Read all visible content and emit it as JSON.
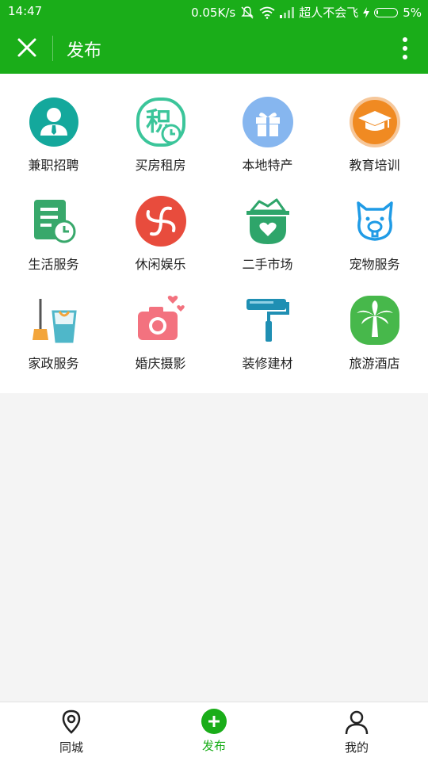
{
  "status_bar": {
    "time": "14:47",
    "speed": "0.05K/s",
    "carrier": "超人不会飞",
    "battery": "5%"
  },
  "header": {
    "title": "发布",
    "close_icon": "close-icon",
    "more_icon": "more-vertical-icon"
  },
  "categories": [
    {
      "label": "兼职招聘",
      "icon": "job-icon",
      "color": "#14a89c"
    },
    {
      "label": "买房租房",
      "icon": "housing-icon",
      "color": "#3bc59a"
    },
    {
      "label": "本地特产",
      "icon": "gift-icon",
      "color": "#86b6ef"
    },
    {
      "label": "教育培训",
      "icon": "graduation-cap-icon",
      "color": "#f08a22"
    },
    {
      "label": "生活服务",
      "icon": "service-icon",
      "color": "#38a86b"
    },
    {
      "label": "休闲娱乐",
      "icon": "entertainment-icon",
      "color": "#e84c3d"
    },
    {
      "label": "二手市场",
      "icon": "second-hand-icon",
      "color": "#2ea56a"
    },
    {
      "label": "宠物服务",
      "icon": "pet-icon",
      "color": "#1f9be6"
    },
    {
      "label": "家政服务",
      "icon": "housekeeping-icon",
      "color": "#4fb7c9"
    },
    {
      "label": "婚庆摄影",
      "icon": "camera-icon",
      "color": "#f3727f"
    },
    {
      "label": "装修建材",
      "icon": "paint-roller-icon",
      "color": "#1f8fb3"
    },
    {
      "label": "旅游酒店",
      "icon": "palm-tree-icon",
      "color": "#47b84b"
    }
  ],
  "tab_bar": {
    "items": [
      {
        "label": "同城",
        "icon": "location-pin-icon"
      },
      {
        "label": "发布",
        "icon": "add-circle-icon"
      },
      {
        "label": "我的",
        "icon": "user-icon"
      }
    ]
  }
}
